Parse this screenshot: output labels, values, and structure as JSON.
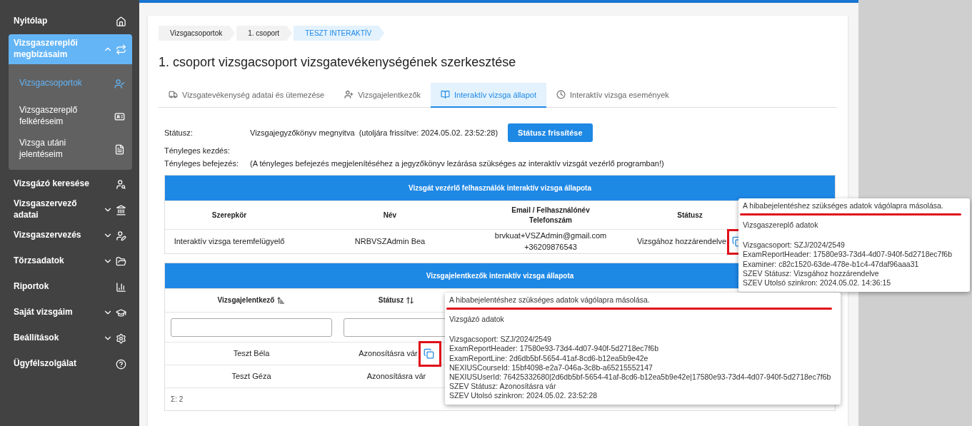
{
  "sidebar": {
    "items": [
      {
        "label": "Nyitólap"
      },
      {
        "label": "Vizsgaszereplői megbízásaim",
        "expanded": true,
        "children": [
          {
            "label": "Vizsgacsoportok",
            "selected": true
          },
          {
            "label": "Vizsgaszereplő felkéréseim",
            "selected": false
          },
          {
            "label": "Vizsga utáni jelentéseim",
            "selected": false
          }
        ]
      },
      {
        "label": "Vizsgázó keresése"
      },
      {
        "label": "Vizsgaszervező adatai",
        "expanded": false
      },
      {
        "label": "Vizsgaszervezés",
        "expanded": false
      },
      {
        "label": "Törzsadatok",
        "expanded": false
      },
      {
        "label": "Riportok"
      },
      {
        "label": "Saját vizsgáim",
        "expanded": false
      },
      {
        "label": "Beállítások",
        "expanded": false
      },
      {
        "label": "Ügyfélszolgálat"
      }
    ]
  },
  "breadcrumb": [
    {
      "label": "Vizsgacsoportok",
      "selected": false
    },
    {
      "label": "1. csoport",
      "selected": false
    },
    {
      "label": "TESZT INTERAKTÍV",
      "selected": true
    }
  ],
  "title": "1. csoport vizsgacsoport vizsgatevékenységének szerkesztése",
  "tabs": [
    {
      "label": "Vizsgatevékenység adatai és ütemezése",
      "selected": false
    },
    {
      "label": "Vizsgajelentkezők",
      "selected": false
    },
    {
      "label": "Interaktív vizsga állapot",
      "selected": true
    },
    {
      "label": "Interaktív vizsga események",
      "selected": false
    }
  ],
  "status": {
    "rows": [
      {
        "label": "Státusz:",
        "value": "Vizsgajegyzőkönyv megnyitva  (utoljára frissítve: 2024.05.02. 23:52:28)"
      },
      {
        "label": "Tényleges kezdés:"
      },
      {
        "label": "Tényleges befejezés:",
        "value": "(A tényleges befejezés megjelenítéséhez a jegyzőkönyv lezárása szükséges az interaktív vizsgát vezérlő programban!)"
      }
    ],
    "button": "Státusz frissítése"
  },
  "controllers_table": {
    "title": "Vizsgát vezérlő felhasználók interaktív vizsga állapota",
    "columns": [
      "Szerepkör",
      "Név",
      "Email / Felhasználónév\nTelefonszám",
      "Státusz"
    ],
    "rows": [
      {
        "cells": [
          "Interaktív vizsga teremfelügyelő",
          "NRBVSZAdmin Bea",
          "brvkuat+VSZAdmin@gmail.com\n+36209876543",
          "Vizsgához hozzárendelve"
        ],
        "copy": true,
        "highlighted": true
      }
    ]
  },
  "candidates_table": {
    "title": "Vizsgajelentkezők interaktív vizsga állapota",
    "columns": [
      {
        "label": "Vizsgajelentkező",
        "sorted": true
      },
      {
        "label": "Státusz",
        "sorted": false
      }
    ],
    "rows": [
      {
        "cells": [
          "Teszt Béla",
          "Azonosításra vár"
        ],
        "copy": true,
        "highlighted": true
      },
      {
        "cells": [
          "Teszt Géza",
          "Azonosításra vár"
        ]
      }
    ],
    "footer": "Σ: 2"
  },
  "tooltips": [
    {
      "title": "A hibabejelentéshez szükséges adatok vágólapra másolása.",
      "underlined": true,
      "heading": "Vizsgaszereplő adatok",
      "lines": [
        "Vizsgacsoport: SZJ/2024/2549",
        "ExamReportHeader: 17580e93-73d4-4d07-940f-5d2718ec7f6b",
        "Examiner: c82c1520-63de-478e-b1c4-47daf96aaa31",
        "SZEV Státusz: Vizsgához hozzárendelve",
        "SZEV Utolsó szinkron: 2024.05.02. 14:36:15"
      ]
    },
    {
      "title": "A hibabejelentéshez szükséges adatok vágólapra másolása.",
      "underlined": true,
      "heading": "Vizsgázó adatok",
      "lines": [
        "Vizsgacsoport: SZJ/2024/2549",
        "ExamReportHeader: 17580e93-73d4-4d07-940f-5d2718ec7f6b",
        "ExamReportLine: 2d6db5bf-5654-41af-8cd6-b12ea5b9e42e",
        "NEXIUSCourseId: 15bf4098-e2a7-046a-3c8b-a65215552147",
        "NEXIUSUserId: 76425332680|2d6db5bf-5654-41af-8cd6-b12ea5b9e42e|17580e93-73d4-4d07-940f-5d2718ec7f6b",
        "SZEV Státusz: Azonosításra vár",
        "SZEV Utolsó szinkron: 2024.05.02. 23:52:28"
      ]
    }
  ]
}
